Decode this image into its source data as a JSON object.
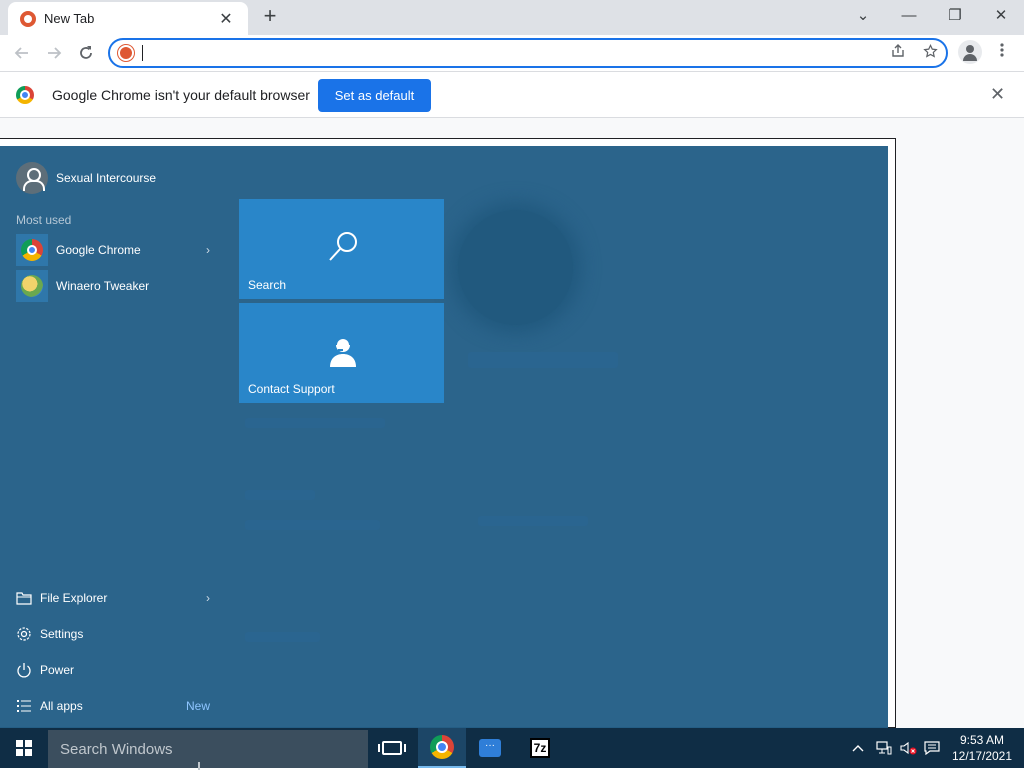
{
  "browser": {
    "tab_title": "New Tab",
    "tab_close": "✕",
    "new_tab": "+",
    "window_controls": {
      "tabsearch": "⌄",
      "minimize": "—",
      "restore": "❐",
      "close": "✕"
    },
    "address_value": "",
    "infobar": {
      "message": "Google Chrome isn't your default browser",
      "button": "Set as default",
      "dismiss": "✕"
    }
  },
  "start_menu": {
    "user_name": "Sexual Intercourse",
    "most_used_label": "Most used",
    "most_used": [
      {
        "label": "Google Chrome",
        "chevron": "›"
      },
      {
        "label": "Winaero Tweaker",
        "chevron": ""
      }
    ],
    "tiles": [
      {
        "label": "Search"
      },
      {
        "label": "Contact Support"
      }
    ],
    "bottom": [
      {
        "label": "File Explorer",
        "chevron": "›",
        "badge": ""
      },
      {
        "label": "Settings",
        "chevron": "",
        "badge": ""
      },
      {
        "label": "Power",
        "chevron": "",
        "badge": ""
      },
      {
        "label": "All apps",
        "chevron": "",
        "badge": "New"
      }
    ]
  },
  "taskbar": {
    "search_placeholder": "Search Windows",
    "seven_zip_label": "7z",
    "clock_time": "9:53 AM",
    "clock_date": "12/17/2021"
  },
  "colors": {
    "start_bg": "#245f87",
    "tile_bg": "#2986c9",
    "taskbar_bg": "#0f2d45",
    "chrome_accent": "#1a73e8"
  },
  "icons": [
    "back-icon",
    "forward-icon",
    "reload-icon",
    "share-icon",
    "star-icon",
    "profile-icon",
    "menu-icon",
    "windows-logo-icon",
    "task-view-icon",
    "chrome-icon",
    "messaging-icon",
    "7zip-icon",
    "chevron-up-icon",
    "network-icon",
    "volume-muted-icon",
    "notifications-icon"
  ]
}
